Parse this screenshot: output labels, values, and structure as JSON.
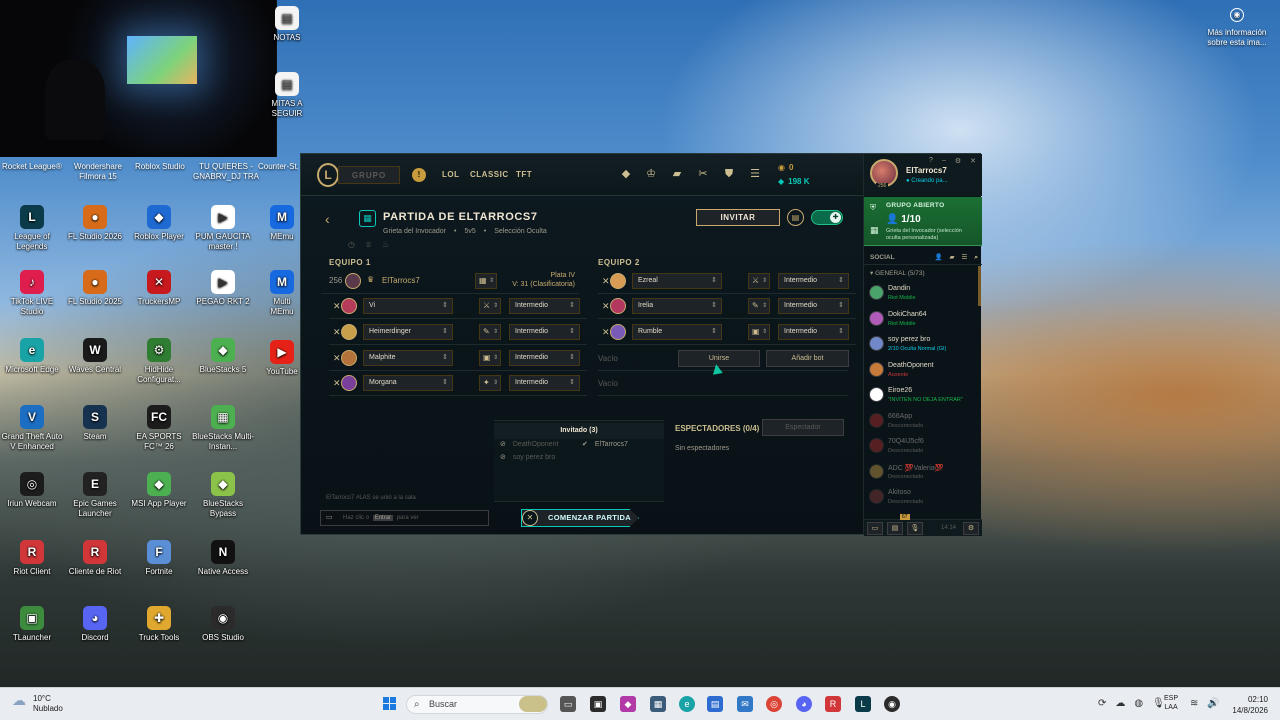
{
  "desktop": {
    "icons": [
      {
        "label": "League of Legends",
        "glyph": "L",
        "color": "#0b3b49"
      },
      {
        "label": "FL Studio 2026",
        "glyph": "●",
        "color": "#d76b19"
      },
      {
        "label": "Roblox Player",
        "glyph": "◆",
        "color": "#1e69d2"
      },
      {
        "label": "PUM GAUCITA master !",
        "glyph": "▶",
        "color": "#ffffff"
      },
      {
        "label": "TikTok LIVE Studio",
        "glyph": "♪",
        "color": "#e01e4d"
      },
      {
        "label": "FL Studio 2025",
        "glyph": "●",
        "color": "#d76b19"
      },
      {
        "label": "TruckersMP",
        "glyph": "✕",
        "color": "#c8191e"
      },
      {
        "label": "PEGAO RKT 2",
        "glyph": "▶",
        "color": "#ffffff"
      },
      {
        "label": "Microsoft Edge",
        "glyph": "e",
        "color": "#1aa3a6"
      },
      {
        "label": "Waves Central",
        "glyph": "W",
        "color": "#1a1a1a"
      },
      {
        "label": "HidHide Configurat...",
        "glyph": "⚙",
        "color": "#2f7d32"
      },
      {
        "label": "BlueStacks 5",
        "glyph": "◆",
        "color": "#4caf50"
      },
      {
        "label": "Grand Theft Auto V Enhanced",
        "glyph": "V",
        "color": "#1b6ec2"
      },
      {
        "label": "Steam",
        "glyph": "S",
        "color": "#16324f"
      },
      {
        "label": "EA SPORTS FC™ 26",
        "glyph": "FC",
        "color": "#1c1c1c"
      },
      {
        "label": "BlueStacks Multi-Instan...",
        "glyph": "▦",
        "color": "#4caf50"
      },
      {
        "label": "Iriun Webcam",
        "glyph": "◎",
        "color": "#1c1c1c"
      },
      {
        "label": "Epic Games Launcher",
        "glyph": "E",
        "color": "#222222"
      },
      {
        "label": "MSI App Player",
        "glyph": "◆",
        "color": "#4caf50"
      },
      {
        "label": "BlueStacks Bypass",
        "glyph": "◆",
        "color": "#8bc34a"
      },
      {
        "label": "Riot Client",
        "glyph": "R",
        "color": "#d13639"
      },
      {
        "label": "Cliente de Riot",
        "glyph": "R",
        "color": "#d13639"
      },
      {
        "label": "Fortnite",
        "glyph": "F",
        "color": "#5a8fd6"
      },
      {
        "label": "Native Access",
        "glyph": "N",
        "color": "#111111"
      },
      {
        "label": "TLauncher",
        "glyph": "▣",
        "color": "#3d8b3d"
      },
      {
        "label": "Discord",
        "glyph": "◕",
        "color": "#5865f2"
      },
      {
        "label": "Truck Tools",
        "glyph": "✚",
        "color": "#e0a82e"
      },
      {
        "label": "OBS Studio",
        "glyph": "◉",
        "color": "#2b2b2b"
      }
    ],
    "top_labels": {
      "rocket": "Rocket League®",
      "wondershare": "Wondershare Filmora 15",
      "roblox_studio": "Roblox Studio",
      "tu_quieres": "TU QUIERES - GNABRV_DJ TRA",
      "counter": "Counter-St...",
      "notas": "NOTAS",
      "mitas": "MITAS A SEGUIR",
      "memu": "MEmu",
      "youtube": "YouTube",
      "multi": "Multi MEmu"
    },
    "info_link": "Más información sobre esta ima..."
  },
  "client": {
    "grupo_label": "GRUPO",
    "nav": [
      "LOL",
      "CLASSIC",
      "TFT"
    ],
    "currency": {
      "rp": "0",
      "be": "198 K"
    },
    "title": "PARTIDA DE ELTARROCS7",
    "subtitle": [
      "Grieta del Invocador",
      "5v5",
      "Selección Oculta"
    ],
    "invite_label": "INVITAR",
    "team1_label": "EQUIPO 1",
    "team2_label": "EQUIPO 2",
    "owner": {
      "level": "256",
      "name": "ElTarrocs7",
      "rank_line1": "Plata IV",
      "rank_line2": "V: 31 (Clasificatoria)"
    },
    "team1_bots": [
      {
        "champion": "Vi",
        "difficulty": "Intermedio",
        "color": "#b43c5a"
      },
      {
        "champion": "Heimerdinger",
        "difficulty": "Intermedio",
        "color": "#c9a04a"
      },
      {
        "champion": "Malphite",
        "difficulty": "Intermedio",
        "color": "#b4733a"
      },
      {
        "champion": "Morgana",
        "difficulty": "Intermedio",
        "color": "#7a3f9a"
      }
    ],
    "team2_bots": [
      {
        "champion": "Ezreal",
        "difficulty": "Intermedio",
        "color": "#d99c54"
      },
      {
        "champion": "Irelia",
        "difficulty": "Intermedio",
        "color": "#b3385f"
      },
      {
        "champion": "Rumble",
        "difficulty": "Intermedio",
        "color": "#7a5ab8"
      }
    ],
    "empty_label": "Vacío",
    "join_label": "Unirse",
    "add_bot_label": "Añadir bot",
    "invited": {
      "title": "Invitado (3)",
      "rows": [
        {
          "name": "DeathOponent",
          "accepted": false
        },
        {
          "name": "ElTarrocs7",
          "accepted": true
        },
        {
          "name": "soy perez bro",
          "accepted": false
        }
      ]
    },
    "spectators": {
      "title": "ESPECTADORES (0/4)",
      "button": "Espectador",
      "empty": "Sin espectadores"
    },
    "chat": {
      "join_message": "ElTarrocs7 #LAS se unió a la sala",
      "placeholder_before": "Haz clic o",
      "placeholder_key": "Entrar",
      "placeholder_after": "para ver"
    },
    "start_label": "COMENZAR PARTIDA"
  },
  "social": {
    "profile_name": "ElTarrocs7",
    "profile_status": "● Creando pa...",
    "profile_level": "256",
    "party_title": "GRUPO ABIERTO",
    "party_count": "1/10",
    "party_desc": "Grieta del Invocador (selección oculta personalizada)",
    "header": "SOCIAL",
    "group_label": "▾ GENERAL (5/73)",
    "friends": [
      {
        "name": "Dandin",
        "sub": "Riot Mobile",
        "state": "online",
        "color": "#4aa36b"
      },
      {
        "name": "DokiChan64",
        "sub": "Riot Mobile",
        "state": "online",
        "color": "#b05bb7"
      },
      {
        "name": "soy perez bro",
        "sub": "2/10 Oculta Normal (GI)",
        "state": "ingame",
        "color": "#7088c8"
      },
      {
        "name": "DeathOponent",
        "sub": "Ausente",
        "state": "away",
        "color": "#c77b3b"
      },
      {
        "name": "Eiroe26",
        "sub": "\"INVITEN NO DEJA ENTRAR\"",
        "state": "online",
        "color": "#ffffff"
      },
      {
        "name": "666App",
        "sub": "Desconectado",
        "state": "offline",
        "color": "#b22d2d"
      },
      {
        "name": "70Q4IJ5cf6",
        "sub": "Desconectado",
        "state": "offline",
        "color": "#b22d2d"
      },
      {
        "name": "ADC 💯Valeria💯",
        "sub": "Desconectado",
        "state": "offline",
        "color": "#c9a04a"
      },
      {
        "name": "Akitoso",
        "sub": "Desconectado",
        "state": "offline",
        "color": "#8c3a3a"
      }
    ],
    "footer_time": "14:14",
    "footer_badge": "67"
  },
  "taskbar": {
    "temp": "10°C",
    "weather": "Nublado",
    "search_placeholder": "Buscar",
    "lang_line1": "ESP",
    "lang_line2": "LAA",
    "time": "02:10",
    "date": "14/8/2026"
  }
}
